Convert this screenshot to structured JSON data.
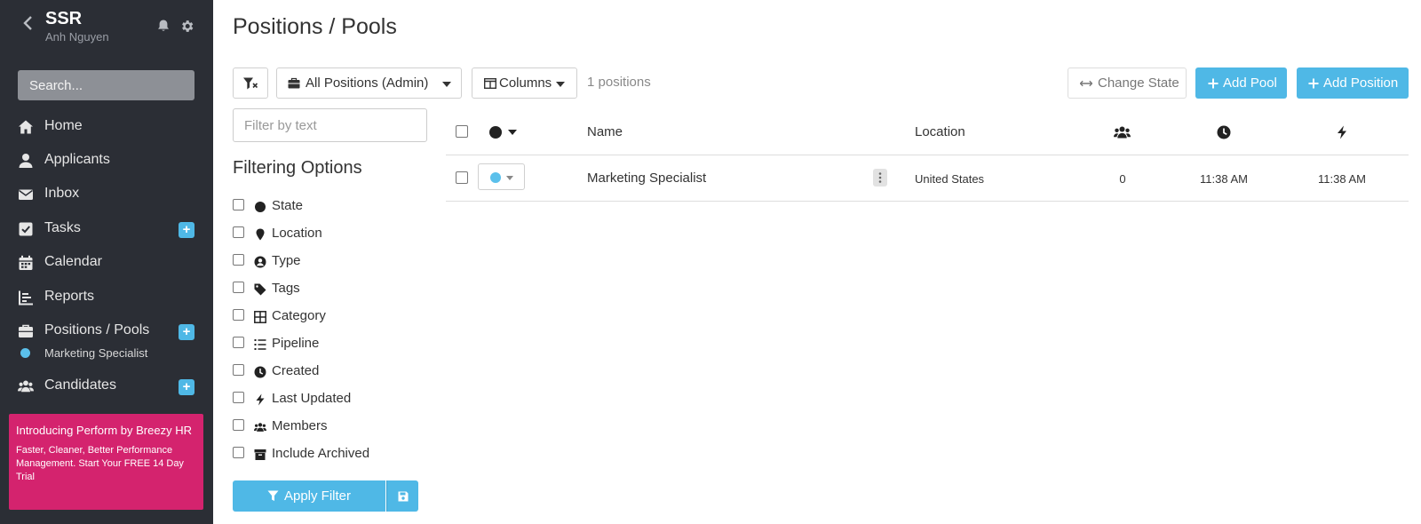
{
  "sidebar": {
    "title": "SSR",
    "user": "Anh Nguyen",
    "search_placeholder": "Search...",
    "items": [
      {
        "label": "Home",
        "icon": "home-icon"
      },
      {
        "label": "Applicants",
        "icon": "user-icon"
      },
      {
        "label": "Inbox",
        "icon": "envelope-icon"
      },
      {
        "label": "Tasks",
        "icon": "checkbox-icon",
        "plus": "+"
      },
      {
        "label": "Calendar",
        "icon": "calendar-icon"
      },
      {
        "label": "Reports",
        "icon": "bar-chart-icon"
      },
      {
        "label": "Positions / Pools",
        "icon": "briefcase-icon",
        "plus": "+"
      },
      {
        "label": "Candidates",
        "icon": "users-icon",
        "plus": "+"
      }
    ],
    "sub_item": "Marketing Specialist",
    "promo": {
      "title": "Introducing Perform by Breezy HR",
      "text": "Faster, Cleaner, Better Performance Management. Start Your FREE 14 Day Trial"
    }
  },
  "main": {
    "title": "Positions / Pools",
    "toolbar": {
      "positions_dropdown": "All Positions (Admin)",
      "columns_dropdown": "Columns",
      "count": "1 positions",
      "change_state": "Change State",
      "add_pool": "Add Pool",
      "add_position": "Add Position"
    },
    "filter": {
      "placeholder": "Filter by text",
      "title": "Filtering Options",
      "options": [
        {
          "label": "State",
          "icon": "circle-icon"
        },
        {
          "label": "Location",
          "icon": "map-marker-icon"
        },
        {
          "label": "Type",
          "icon": "user-circle-icon"
        },
        {
          "label": "Tags",
          "icon": "tag-icon"
        },
        {
          "label": "Category",
          "icon": "grid-icon"
        },
        {
          "label": "Pipeline",
          "icon": "list-icon"
        },
        {
          "label": "Created",
          "icon": "clock-icon"
        },
        {
          "label": "Last Updated",
          "icon": "bolt-icon"
        },
        {
          "label": "Members",
          "icon": "users-icon"
        },
        {
          "label": "Include Archived",
          "icon": "archive-icon"
        }
      ],
      "apply_label": "Apply Filter"
    },
    "table": {
      "headers": {
        "name": "Name",
        "location": "Location"
      },
      "rows": [
        {
          "name": "Marketing Specialist",
          "location": "United States",
          "members": "0",
          "created": "11:38 AM",
          "updated": "11:38 AM"
        }
      ]
    }
  },
  "colors": {
    "accent": "#4fb8e6",
    "sidebar": "#2b2e35",
    "promo": "#d4236e",
    "state_dot": "#5bc0eb"
  }
}
